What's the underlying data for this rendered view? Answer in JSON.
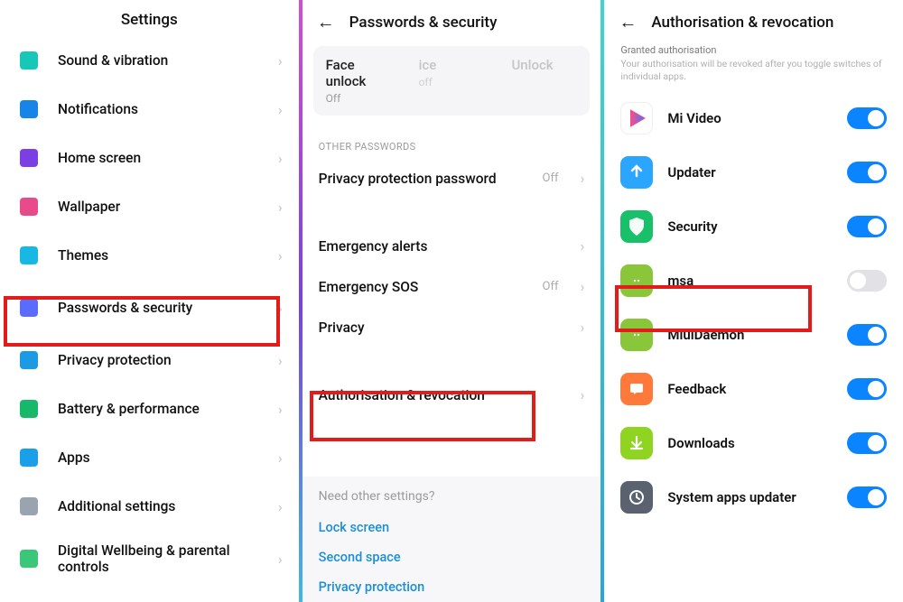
{
  "panel1": {
    "title": "Settings",
    "items": [
      {
        "label": "Sound & vibration",
        "iconColor": "#17c8b8"
      },
      {
        "label": "Notifications",
        "iconColor": "#1784e8"
      },
      {
        "label": "Home screen",
        "iconColor": "#7b3fe4"
      },
      {
        "label": "Wallpaper",
        "iconColor": "#e84b8a"
      },
      {
        "label": "Themes",
        "iconColor": "#17b8e4"
      },
      {
        "label": "Passwords & security",
        "iconColor": "#5a6bff"
      },
      {
        "label": "Privacy protection",
        "iconColor": "#1a9be4"
      },
      {
        "label": "Battery & performance",
        "iconColor": "#18b86a"
      },
      {
        "label": "Apps",
        "iconColor": "#1aa0e8"
      },
      {
        "label": "Additional settings",
        "iconColor": "#9aa4b0"
      },
      {
        "label": "Digital Wellbeing & parental controls",
        "iconColor": "#3ac77a"
      }
    ]
  },
  "panel2": {
    "title": "Passwords & security",
    "face_unlock": {
      "title": "Face unlock",
      "sub": "Off",
      "alt1_title": "ice",
      "alt1_sub": "off",
      "alt2_title": "Unlock"
    },
    "section_label": "OTHER PASSWORDS",
    "items": [
      {
        "label": "Privacy protection password",
        "value": "Off"
      },
      {
        "label": "Emergency alerts",
        "value": ""
      },
      {
        "label": "Emergency SOS",
        "value": "Off"
      },
      {
        "label": "Privacy",
        "value": ""
      },
      {
        "label": "Authorisation & revocation",
        "value": ""
      }
    ],
    "other": {
      "title": "Need other settings?",
      "links": [
        "Lock screen",
        "Second space",
        "Privacy protection"
      ]
    }
  },
  "panel3": {
    "title": "Authorisation & revocation",
    "desc_title": "Granted authorisation",
    "desc_text": "Your authorisation will be revoked after you toggle switches of individual apps.",
    "apps": [
      {
        "label": "Mi Video",
        "color": "#ffffff",
        "on": true
      },
      {
        "label": "Updater",
        "color": "#2aa6ff",
        "on": true
      },
      {
        "label": "Security",
        "color": "#18c06a",
        "on": true
      },
      {
        "label": "msa",
        "color": "#8ac63a",
        "on": false
      },
      {
        "label": "MiuiDaemon",
        "color": "#8ac63a",
        "on": true
      },
      {
        "label": "Feedback",
        "color": "#ff7a3a",
        "on": true
      },
      {
        "label": "Downloads",
        "color": "#8ed420",
        "on": true
      },
      {
        "label": "System apps updater",
        "color": "#5a6270",
        "on": true
      }
    ]
  }
}
